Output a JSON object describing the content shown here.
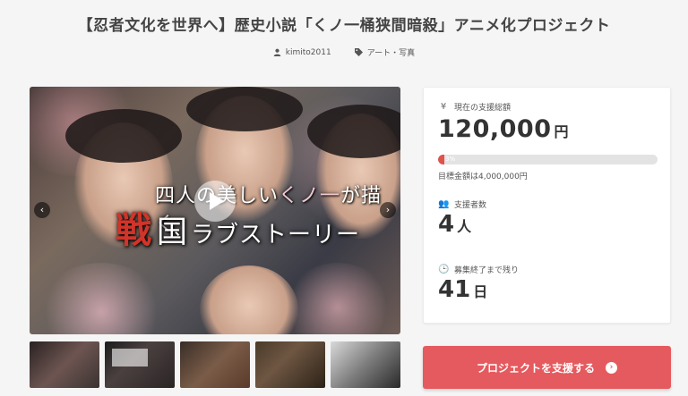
{
  "project": {
    "title": "【忍者文化を世界へ】歴史小説「くノ一桶狭間暗殺」アニメ化プロジェクト",
    "author": "kimito2011",
    "category": "アート・写真"
  },
  "hero": {
    "line1_pre": "四人の美しい",
    "line1_accent": "くノ一",
    "line1_post": "が描く",
    "line2_big": "戦",
    "line2_mid": "国",
    "line2_rest": "ラブストーリー",
    "prev_icon": "chevron-left-icon",
    "next_icon": "chevron-right-icon",
    "play_icon": "play-icon"
  },
  "stats": {
    "funded_label": "現在の支援総額",
    "funded_amount": "120,000",
    "funded_unit": "円",
    "progress_percent": 3,
    "progress_text": "3%",
    "goal_text": "目標金額は4,000,000円",
    "backers_label": "支援者数",
    "backers_count": "4",
    "backers_unit": "人",
    "remaining_label": "募集終了まで残り",
    "remaining_count": "41",
    "remaining_unit": "日"
  },
  "cta": {
    "label": "プロジェクトを支援する",
    "icon": "arrow-circle-right-icon"
  },
  "colors": {
    "accent": "#e55a5e",
    "progress_fill": "#e1514e"
  }
}
